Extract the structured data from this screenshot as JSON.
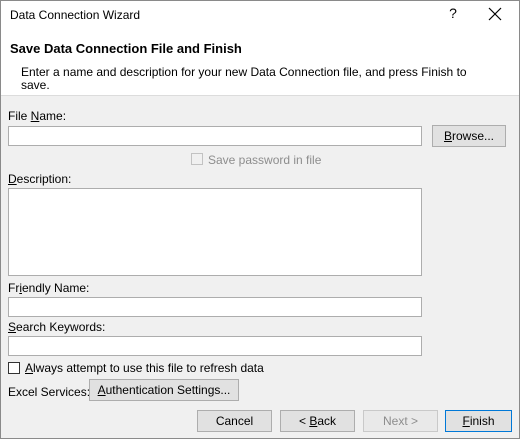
{
  "window": {
    "title": "Data Connection Wizard",
    "help_glyph": "?"
  },
  "header": {
    "title": "Save Data Connection File and Finish",
    "description": "Enter a name and description for your new Data Connection file, and press Finish to save."
  },
  "form": {
    "file_name_label_pre": "File ",
    "file_name_label_u": "N",
    "file_name_label_post": "ame:",
    "file_name_value": "",
    "browse_button_pre": "",
    "browse_button_u": "B",
    "browse_button_post": "rowse...",
    "save_password_label": "Save password in file",
    "description_label_pre": "",
    "description_label_u": "D",
    "description_label_post": "escription:",
    "description_value": "",
    "friendly_name_label_pre": "Fr",
    "friendly_name_label_u": "i",
    "friendly_name_label_post": "endly Name:",
    "friendly_name_value": "",
    "search_keywords_label_pre": "",
    "search_keywords_label_u": "S",
    "search_keywords_label_post": "earch Keywords:",
    "search_keywords_value": "",
    "always_refresh_label_pre": "",
    "always_refresh_label_u": "A",
    "always_refresh_label_post": "lways attempt to use this file to refresh data",
    "excel_services_label": "Excel Services:",
    "auth_settings_pre": "",
    "auth_settings_u": "A",
    "auth_settings_post": "uthentication Settings..."
  },
  "footer": {
    "cancel": "Cancel",
    "back_pre": "< ",
    "back_u": "B",
    "back_post": "ack",
    "next": "Next >",
    "finish_pre": "",
    "finish_u": "F",
    "finish_post": "inish"
  },
  "icons": {
    "close": "close-icon",
    "help": "help-icon"
  }
}
